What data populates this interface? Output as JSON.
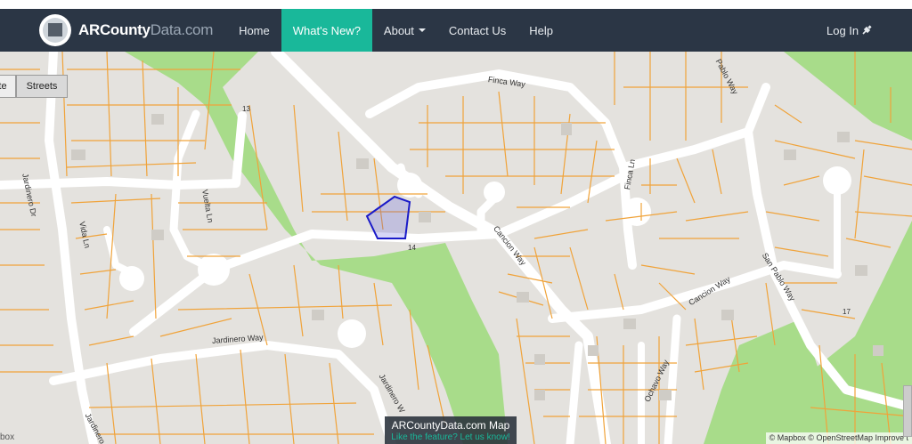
{
  "brand": {
    "name": "ARCounty",
    "domain": "Data.com"
  },
  "nav": {
    "home": "Home",
    "whats_new": "What's New?",
    "about": "About",
    "contact": "Contact Us",
    "help": "Help",
    "login": "Log In"
  },
  "map": {
    "layers": {
      "satellite": "te",
      "streets": "Streets"
    },
    "streets": {
      "finca_way": "Finca Way",
      "pablo_way": "Pablo Way",
      "jardinero_dr": "Jardinero Dr",
      "vida_ln": "Vida Ln",
      "vuelta_ln": "Vuelta Ln",
      "cancion_way_1": "Cancion Way",
      "cancion_way_2": "Cancion Way",
      "finca_ln": "Finca Ln",
      "san_pablo_way": "San Pablo Way",
      "jardinero_way": "Jardinero Way",
      "jardinero_w": "Jardinero W",
      "jardinero_bottom": "Jardinero D",
      "ochavo_way": "Ochavo Way"
    },
    "hole_numbers": {
      "h13": "13",
      "h14": "14",
      "h17": "17"
    },
    "caption": {
      "title": "ARCountyData.com Map",
      "subtitle": "Like the feature? Let us know!"
    },
    "attribution": "© Mapbox © OpenStreetMap  Improve t",
    "logo_text": "box"
  },
  "colors": {
    "navbar": "#2b3645",
    "accent": "#19b89a",
    "map_bg": "#e4e2de",
    "parcel_line": "#f0a33a",
    "golf_green": "#a8dc8a",
    "road": "#ffffff",
    "selected_parcel": "#1a1ac8"
  }
}
